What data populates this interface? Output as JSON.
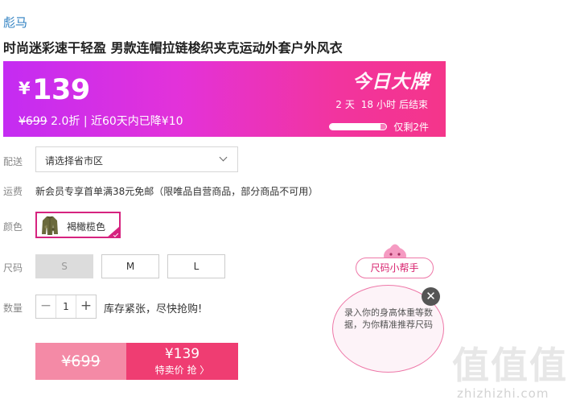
{
  "brand": "彪马",
  "product_title": "时尚迷彩速干轻盈 男款连帽拉链梭织夹克运动外套户外风衣",
  "banner": {
    "currency": "¥",
    "price": "139",
    "original_price": "¥699",
    "discount": "2.0折",
    "separator": "|",
    "drop_note": "近60天内已降¥10",
    "deal_title": "今日大牌",
    "countdown": {
      "days": "2",
      "days_unit": "天",
      "hours": "18",
      "hours_unit": "小时",
      "suffix": "后结束"
    },
    "stock_text": "仅剩2件",
    "stock_fill_fraction": 0.9
  },
  "delivery": {
    "label": "配送",
    "placeholder": "请选择省市区"
  },
  "shipping": {
    "label": "运费",
    "text": "新会员专享首单满38元免邮（限唯品自营商品，部分商品不可用）"
  },
  "color": {
    "label": "颜色",
    "selected": "褐橄榄色"
  },
  "size": {
    "label": "尺码",
    "options": [
      "S",
      "M",
      "L"
    ],
    "disabled": [
      "S"
    ]
  },
  "quantity": {
    "label": "数量",
    "value": "1",
    "minus": "−",
    "plus": "+",
    "hint": "库存紧张，尽快抢购!"
  },
  "buy": {
    "original_price": "¥699",
    "deal_price": "¥139",
    "deal_label": "特卖价 抢 〉"
  },
  "size_helper": {
    "pill": "尺码小帮手",
    "bubble_text": "录入你的身高体重等数据，为你精准推荐尺码",
    "close": "✕"
  },
  "watermark": {
    "logo": "值值值",
    "site": "zhizhizhi.com"
  },
  "colors": {
    "brand_link": "#2d7fc1",
    "accent": "#d6237f",
    "buy_button": "#ef3d72",
    "buy_original": "#f48aa6"
  }
}
